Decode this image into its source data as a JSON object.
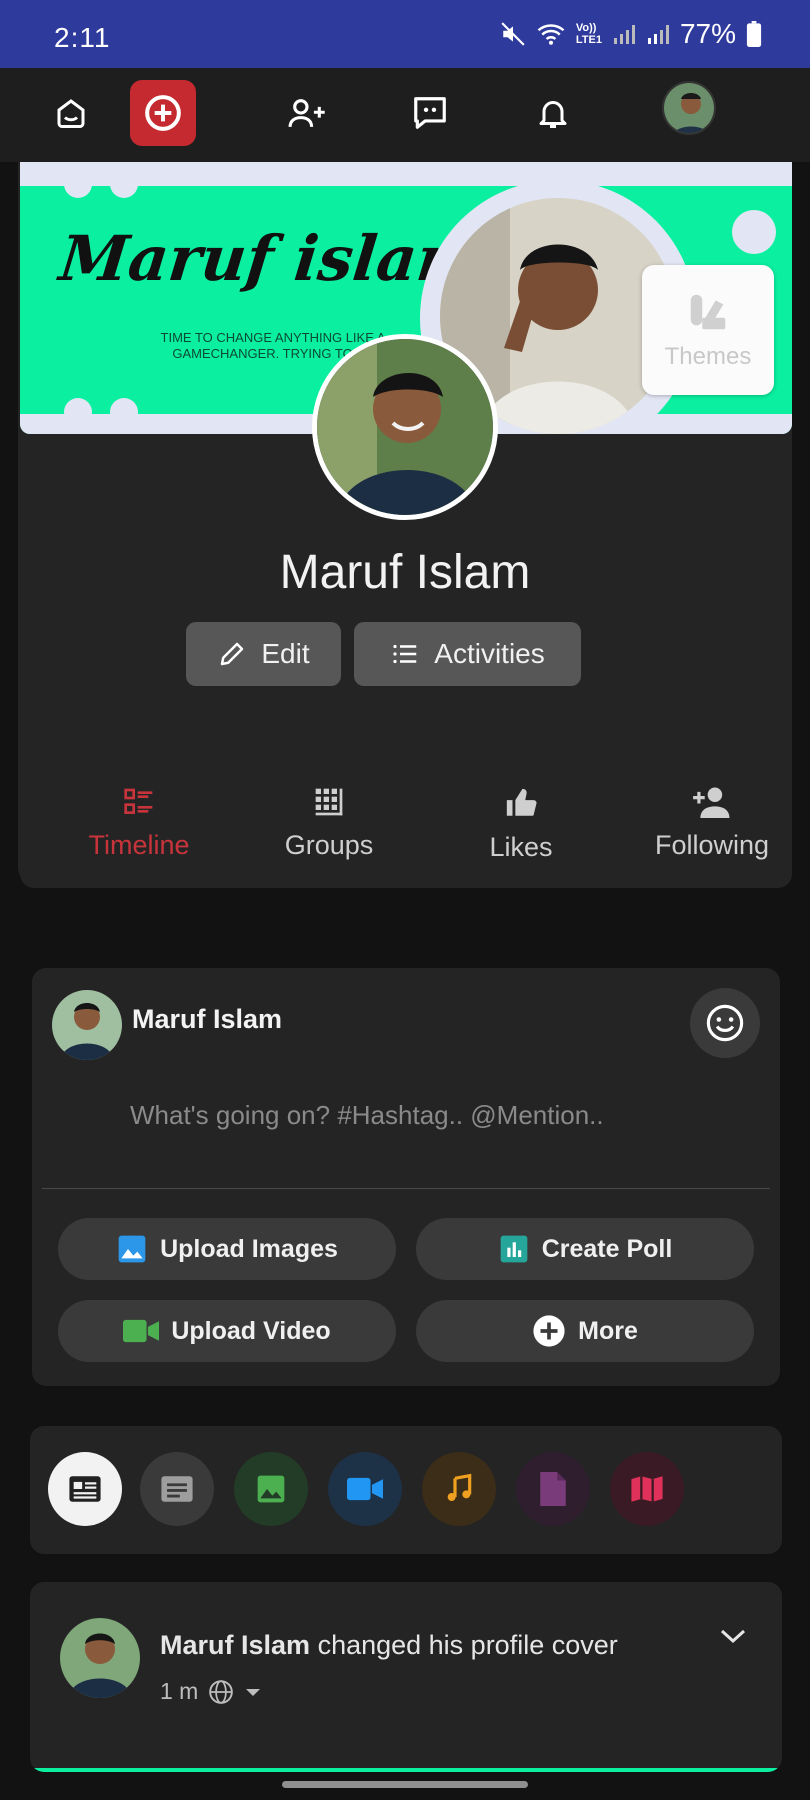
{
  "status_bar": {
    "time": "2:11",
    "lte_label_top": "Vo))",
    "lte_label_bottom": "LTE1",
    "battery": "77%"
  },
  "top_nav": {
    "items": [
      "home-icon",
      "create-icon",
      "add-friend-icon",
      "messages-icon",
      "notifications-icon",
      "avatar"
    ],
    "accent": "#c62a31"
  },
  "cover": {
    "script_text": "Maruf islam",
    "tagline": "TIME TO CHANGE ANYTHING LIKE A GAMECHANGER. TRYING TO BE",
    "background": "#0af0a0"
  },
  "themes_button": {
    "label": "Themes"
  },
  "profile": {
    "name": "Maruf Islam",
    "edit_label": "Edit",
    "activities_label": "Activities"
  },
  "tabs": [
    {
      "label": "Timeline",
      "active": true
    },
    {
      "label": "Groups",
      "active": false
    },
    {
      "label": "Likes",
      "active": false
    },
    {
      "label": "Following",
      "active": false
    }
  ],
  "composer": {
    "user_name": "Maruf Islam",
    "placeholder": "What's going on? #Hashtag.. @Mention..",
    "actions": {
      "upload_images": "Upload Images",
      "create_poll": "Create Poll",
      "upload_video": "Upload Video",
      "more": "More"
    }
  },
  "filters": [
    "all-posts-icon",
    "text-icon",
    "image-icon",
    "video-icon",
    "music-icon",
    "file-icon",
    "map-icon"
  ],
  "post": {
    "author": "Maruf Islam",
    "action": "changed his profile cover",
    "time": "1 m"
  }
}
